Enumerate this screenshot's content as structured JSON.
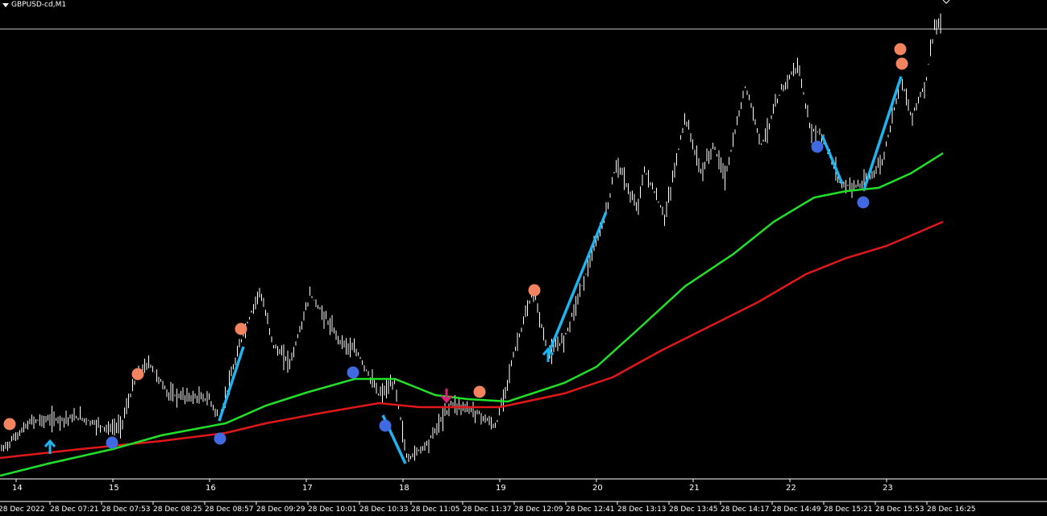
{
  "window": {
    "symbol_label": "GBPUSD-cd,M1",
    "menu_icon": "triangle-down-icon"
  },
  "colors": {
    "background": "#000000",
    "candles": "#ffffff",
    "ma_fast": "#22e02a",
    "ma_slow": "#e01818",
    "trend_line": "#1eb4f0",
    "dot_high": "#f4845f",
    "dot_low": "#4169e1",
    "arrow_up": "#1eb4f0",
    "arrow_down": "#e0207a",
    "price_line": "#c8c8c8"
  },
  "chart_data": {
    "type": "line",
    "title": "GBPUSD-cd,M1",
    "xlabel": "",
    "ylabel": "",
    "grid": false,
    "x_axis_ticks": [
      "14",
      "15",
      "16",
      "17",
      "18",
      "19",
      "20",
      "21",
      "22",
      "23"
    ],
    "time_labels": [
      "28 Dec 2022",
      "28 Dec 07:21",
      "28 Dec 07:53",
      "28 Dec 08:25",
      "28 Dec 08:57",
      "28 Dec 09:29",
      "28 Dec 10:01",
      "28 Dec 10:33",
      "28 Dec 11:05",
      "28 Dec 11:37",
      "28 Dec 12:09",
      "28 Dec 12:41",
      "28 Dec 13:13",
      "28 Dec 13:45",
      "28 Dec 14:17",
      "28 Dec 14:49",
      "28 Dec 15:21",
      "28 Dec 15:53",
      "28 Dec 16:25"
    ],
    "series": []
  }
}
